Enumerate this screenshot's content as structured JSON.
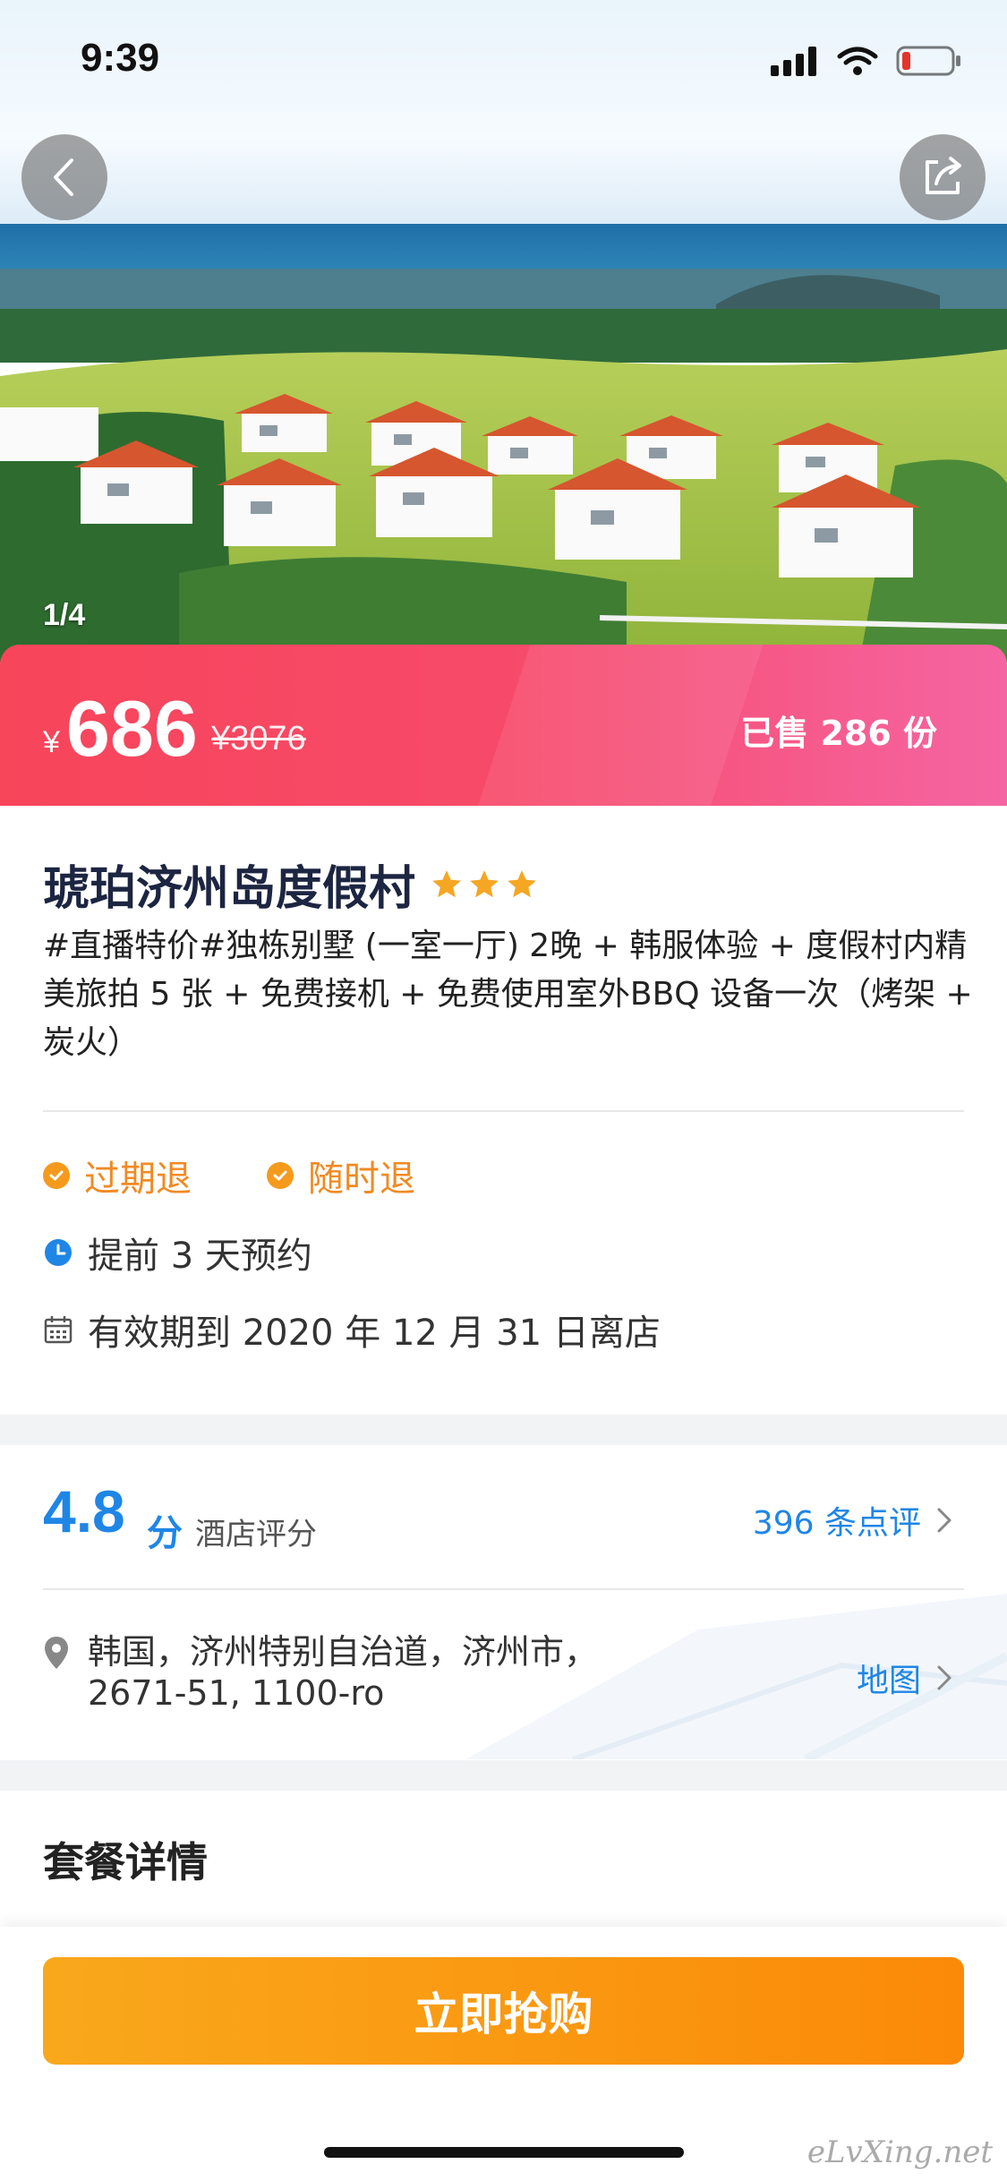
{
  "status_bar": {
    "time": "9:39"
  },
  "hero": {
    "image_counter": "1/4",
    "image_subject": "resort-villas-photo"
  },
  "price": {
    "currency_symbol": "¥",
    "current": "686",
    "original": "¥3076",
    "sold_text": "已售 286 份"
  },
  "product": {
    "title": "琥珀济州岛度假村",
    "star_rating": 3,
    "description": "#直播特价#独栋别墅 (一室一厅) 2晚 + 韩服体验 + 度假村内精美旅拍 5 张 + 免费接机 + 免费使用室外BBQ 设备一次（烤架 + 炭火）",
    "tags": [
      "过期退",
      "随时退"
    ],
    "advance_booking": "提前 3 天预约",
    "validity": "有效期到 2020 年 12 月 31 日离店"
  },
  "rating": {
    "score": "4.8",
    "unit": "分",
    "label": "酒店评分",
    "reviews_link": "396 条点评"
  },
  "location": {
    "address_line1": "韩国，济州特别自治道，济州市，",
    "address_line2": "2671-51, 1100-ro",
    "map_link": "地图"
  },
  "package": {
    "section_title": "套餐详情"
  },
  "bottom": {
    "buy_label": "立即抢购",
    "watermark": "eLvXing.net"
  },
  "colors": {
    "accent_blue": "#1f86e6",
    "tag_orange": "#f08a24",
    "price_gradient_start": "#f7455a",
    "price_gradient_end": "#f565a2",
    "buy_button": "#fb8a08",
    "star": "#f5a623"
  },
  "icons": {
    "back": "chevron-left-icon",
    "share": "share-icon",
    "tag_check": "check-circle-icon",
    "clock": "clock-icon",
    "calendar": "calendar-icon",
    "location": "map-pin-icon",
    "chevron": "chevron-right-icon"
  }
}
